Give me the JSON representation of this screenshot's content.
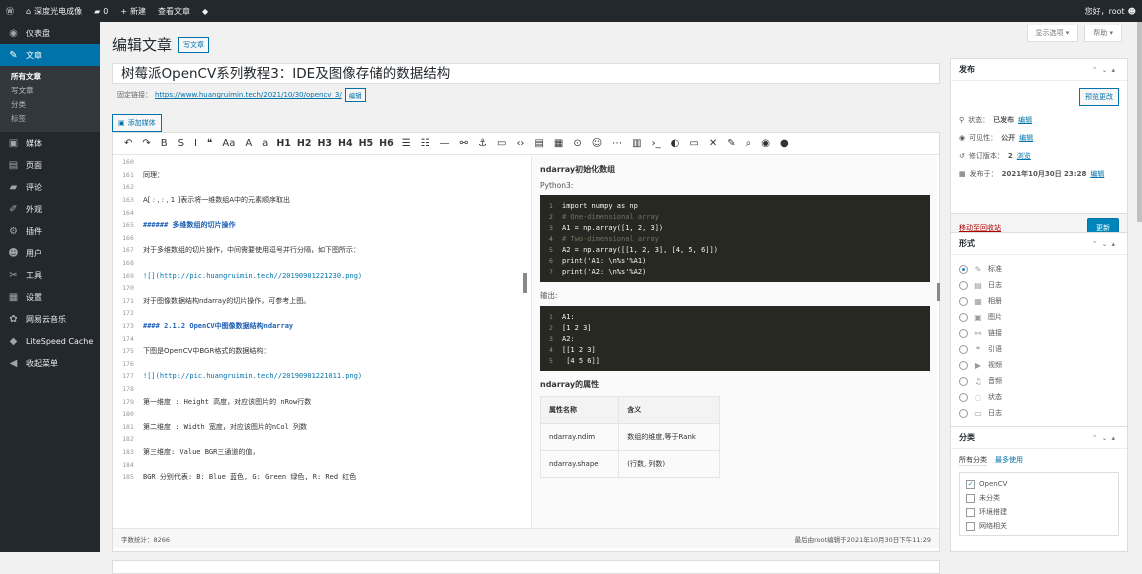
{
  "adminbar": {
    "site_name": "深度光电成像",
    "comments_count": "0",
    "new_label": "新建",
    "view_post": "查看文章",
    "greeting": "您好，root"
  },
  "sidebar": {
    "items": [
      {
        "label": "仪表盘",
        "icon": "dashboard-icon",
        "glyph": "◉"
      },
      {
        "label": "文章",
        "icon": "pushpin-icon",
        "glyph": "✎",
        "current": true
      },
      {
        "label": "媒体",
        "icon": "media-icon",
        "glyph": "▣"
      },
      {
        "label": "页面",
        "icon": "page-icon",
        "glyph": "▤"
      },
      {
        "label": "评论",
        "icon": "comment-icon",
        "glyph": "▰"
      },
      {
        "label": "外观",
        "icon": "appearance-icon",
        "glyph": "✐"
      },
      {
        "label": "插件",
        "icon": "plugin-icon",
        "glyph": "⚙"
      },
      {
        "label": "用户",
        "icon": "user-icon",
        "glyph": "☻"
      },
      {
        "label": "工具",
        "icon": "tool-icon",
        "glyph": "✂"
      },
      {
        "label": "设置",
        "icon": "settings-icon",
        "glyph": "▦"
      },
      {
        "label": "网易云音乐",
        "icon": "music-icon",
        "glyph": "✿"
      },
      {
        "label": "LiteSpeed Cache",
        "icon": "litespeed-icon",
        "glyph": "◆"
      },
      {
        "label": "收起菜单",
        "icon": "collapse-icon",
        "glyph": "◀"
      }
    ],
    "submenu": [
      "所有文章",
      "写文章",
      "分类",
      "标签"
    ]
  },
  "screen_options": "显示选项 ▾",
  "help": "帮助 ▾",
  "page_title": "编辑文章",
  "add_new": "写文章",
  "post_title": "树莓派OpenCV系列教程3：IDE及图像存储的数据结构",
  "permalink": {
    "label": "固定链接：",
    "url": "https://www.huangruimin.tech/2021/10/30/opencv_3/",
    "edit": "编辑"
  },
  "add_media": "添加媒体",
  "toolbar": [
    "↶",
    "↷",
    "B",
    "S",
    "I",
    "❝",
    "Aa",
    "A",
    "a",
    "H1",
    "H2",
    "H3",
    "H4",
    "H5",
    "H6",
    "☰",
    "☷",
    "—",
    "⚯",
    "⚓",
    "▭",
    "‹›",
    "▤",
    "▦",
    "⊙",
    "☺",
    "⋯",
    "▥",
    "›_",
    "◐",
    "▭",
    "✕",
    "✎",
    "⌕",
    "◉",
    "●"
  ],
  "editor_lines": [
    {
      "n": "160",
      "t": "",
      "cls": ""
    },
    {
      "n": "161",
      "t": "同理：",
      "cls": ""
    },
    {
      "n": "162",
      "t": "",
      "cls": ""
    },
    {
      "n": "163",
      "t": "A[ : , : , 1 ]表示将一维数组A中的元素顺序取出",
      "cls": ""
    },
    {
      "n": "164",
      "t": "",
      "cls": ""
    },
    {
      "n": "165",
      "t": "###### 多维数组的切片操作",
      "cls": "head"
    },
    {
      "n": "166",
      "t": "",
      "cls": ""
    },
    {
      "n": "167",
      "t": "对于多维数组的切片操作，中间需要使用逗号并行分隔，如下图所示：",
      "cls": ""
    },
    {
      "n": "168",
      "t": "",
      "cls": ""
    },
    {
      "n": "169",
      "t": "![](http://pic.huangruimin.tech//20190901221230.png)",
      "cls": "link"
    },
    {
      "n": "170",
      "t": "",
      "cls": ""
    },
    {
      "n": "171",
      "t": "对于图像数据结构ndarray的切片操作，可参考上图。",
      "cls": ""
    },
    {
      "n": "172",
      "t": "",
      "cls": ""
    },
    {
      "n": "173",
      "t": "#### 2.1.2 OpenCV中图像数据结构ndarray",
      "cls": "head"
    },
    {
      "n": "174",
      "t": "",
      "cls": ""
    },
    {
      "n": "175",
      "t": "下图是OpenCV中BGR格式的数据结构：",
      "cls": ""
    },
    {
      "n": "176",
      "t": "",
      "cls": ""
    },
    {
      "n": "177",
      "t": "![](http://pic.huangruimin.tech//20190901221011.png)",
      "cls": "link"
    },
    {
      "n": "178",
      "t": "",
      "cls": ""
    },
    {
      "n": "179",
      "t": "第一维度 : Height 高度，对应该图片的 nRow行数",
      "cls": "mono"
    },
    {
      "n": "180",
      "t": "",
      "cls": ""
    },
    {
      "n": "181",
      "t": "第二维度 : Width 宽度，对应该图片的nCol 列数",
      "cls": "mono"
    },
    {
      "n": "182",
      "t": "",
      "cls": ""
    },
    {
      "n": "183",
      "t": "第三维度: Value BGR三通道的值，",
      "cls": "mono"
    },
    {
      "n": "184",
      "t": "",
      "cls": ""
    },
    {
      "n": "185",
      "t": "BGR 分别代表: B: Blue 蓝色, G: Green 绿色, R: Red 红色",
      "cls": "mono"
    }
  ],
  "preview": {
    "heading1": "ndarray初始化数组",
    "label1": "Python3:",
    "code1": [
      {
        "n": "1",
        "c": "import numpy as np",
        "cm": false
      },
      {
        "n": "2",
        "c": "# One-dimensional array",
        "cm": true
      },
      {
        "n": "3",
        "c": "A1 = np.array([1, 2, 3])",
        "cm": false
      },
      {
        "n": "4",
        "c": "# Two-dimensional array",
        "cm": true
      },
      {
        "n": "5",
        "c": "A2 = np.array([[1, 2, 3], [4, 5, 6]])",
        "cm": false
      },
      {
        "n": "6",
        "c": "print('A1: \\n%s'%A1)",
        "cm": false
      },
      {
        "n": "7",
        "c": "print('A2: \\n%s'%A2)",
        "cm": false
      }
    ],
    "label2": "输出:",
    "code2": [
      {
        "n": "1",
        "c": "A1:",
        "cm": false
      },
      {
        "n": "2",
        "c": "[1 2 3]",
        "cm": false
      },
      {
        "n": "3",
        "c": "A2:",
        "cm": false
      },
      {
        "n": "4",
        "c": "[[1 2 3]",
        "cm": false
      },
      {
        "n": "5",
        "c": " [4 5 6]]",
        "cm": false
      }
    ],
    "heading2": "ndarray的属性",
    "table_head": [
      "属性名称",
      "含义"
    ],
    "table_rows": [
      [
        "ndarray.ndim",
        "数组的维度,等于Rank"
      ],
      [
        "ndarray.shape",
        "(行数, 列数)"
      ]
    ]
  },
  "status": {
    "word_count": "字数统计：8266",
    "last_edit": "最后由root编辑于2021年10月30日下午11:29"
  },
  "publish": {
    "title": "发布",
    "preview_btn": "预览更改",
    "status_label": "状态：",
    "status_value": "已发布",
    "visibility_label": "可见性：",
    "visibility_value": "公开",
    "revisions_label": "修订版本：",
    "revisions_value": "2",
    "browse": "浏览",
    "published_label": "发布于：",
    "published_value": "2021年10月30日 23:28",
    "edit": "编辑",
    "trash": "移动至回收站",
    "update": "更新"
  },
  "format": {
    "title": "形式",
    "options": [
      {
        "label": "标准",
        "checked": true,
        "icon": "pushpin-icon",
        "glyph": "✎"
      },
      {
        "label": "日志",
        "checked": false,
        "icon": "aside-icon",
        "glyph": "▤"
      },
      {
        "label": "相册",
        "checked": false,
        "icon": "gallery-icon",
        "glyph": "▦"
      },
      {
        "label": "图片",
        "checked": false,
        "icon": "image-icon",
        "glyph": "▣"
      },
      {
        "label": "链接",
        "checked": false,
        "icon": "link-icon",
        "glyph": "⚯"
      },
      {
        "label": "引语",
        "checked": false,
        "icon": "quote-icon",
        "glyph": "❝"
      },
      {
        "label": "视频",
        "checked": false,
        "icon": "video-icon",
        "glyph": "▶"
      },
      {
        "label": "音频",
        "checked": false,
        "icon": "audio-icon",
        "glyph": "♫"
      },
      {
        "label": "状态",
        "checked": false,
        "icon": "status-icon",
        "glyph": "◌"
      },
      {
        "label": "日志",
        "checked": false,
        "icon": "chat-icon",
        "glyph": "▭"
      }
    ]
  },
  "categories": {
    "title": "分类",
    "tab_all": "所有分类",
    "tab_most": "最多使用",
    "items": [
      {
        "label": "OpenCV",
        "checked": true
      },
      {
        "label": "未分类",
        "checked": false
      },
      {
        "label": "环境搭建",
        "checked": false
      },
      {
        "label": "网络相关",
        "checked": false
      }
    ]
  },
  "colors": {
    "accent": "#0073aa",
    "sidebar": "#23282d",
    "current": "#0073aa"
  }
}
